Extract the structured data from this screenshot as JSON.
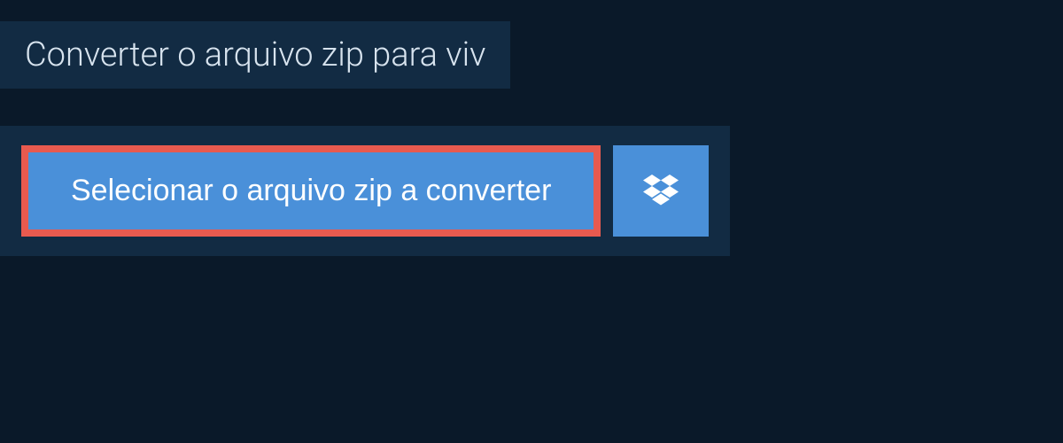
{
  "title": "Converter o arquivo zip para viv",
  "select_button_label": "Selecionar o arquivo zip a converter",
  "colors": {
    "background_dark": "#0a1929",
    "panel": "#122b43",
    "button_blue": "#4a90d9",
    "highlight_red": "#e85a4f",
    "text_light": "#d7e3ee"
  }
}
